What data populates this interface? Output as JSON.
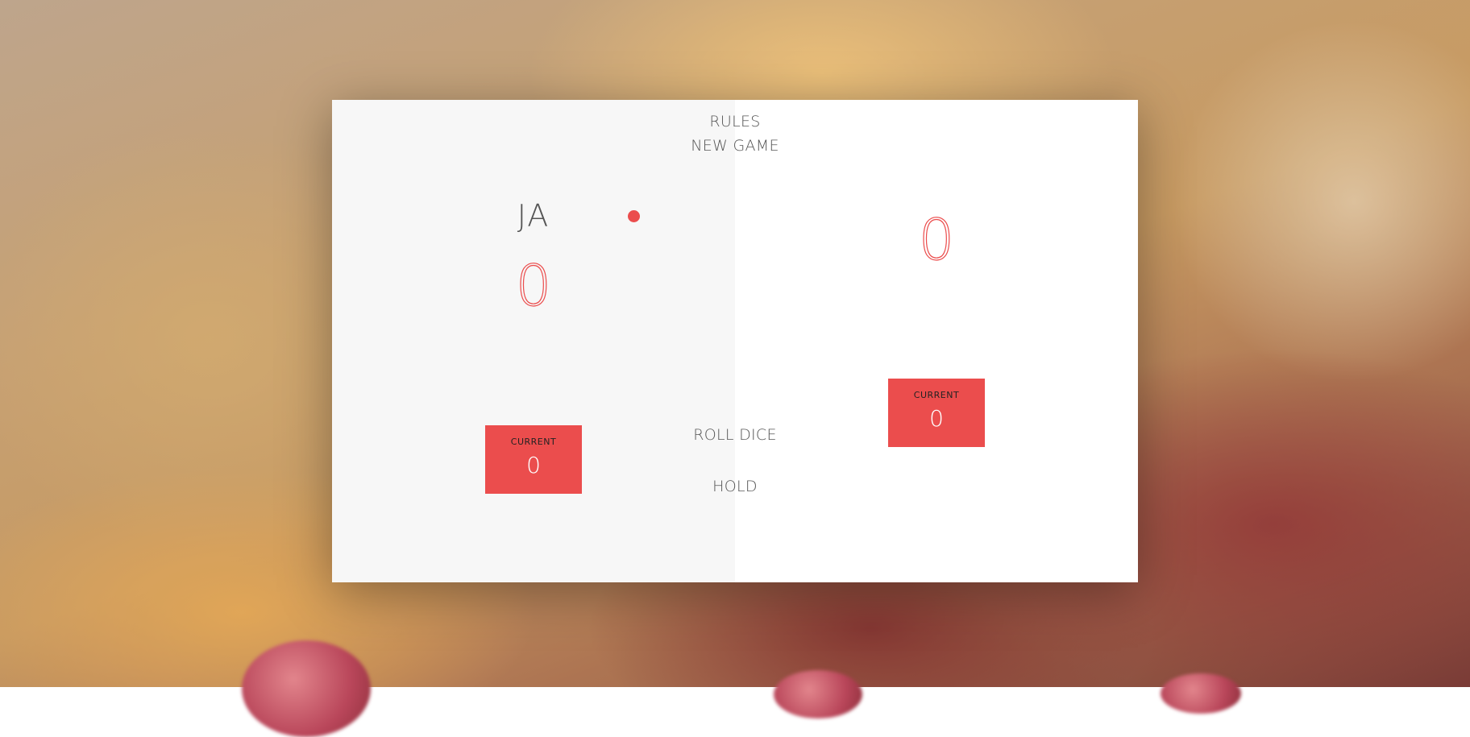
{
  "colors": {
    "accent": "#eb4d4d",
    "text": "#555555",
    "left_panel": "#f7f7f7",
    "right_panel": "#ffffff"
  },
  "controls": {
    "rules": "RULES",
    "new_game": "NEW GAME",
    "roll_dice": "ROLL DICE",
    "hold": "HOLD"
  },
  "players": [
    {
      "name": "JA",
      "score": "0",
      "current_label": "CURRENT",
      "current_score": "0",
      "active": true
    },
    {
      "name": "",
      "score": "0",
      "current_label": "CURRENT",
      "current_score": "0",
      "active": false
    }
  ]
}
